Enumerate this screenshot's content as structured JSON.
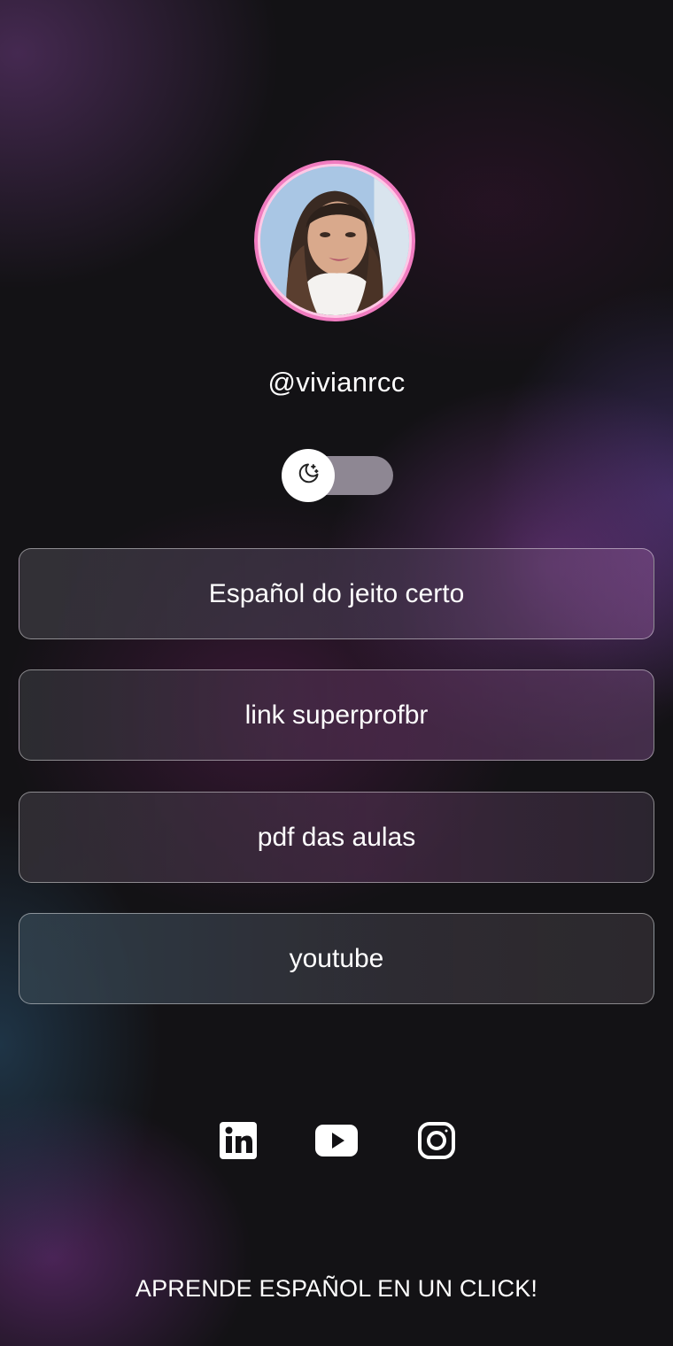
{
  "profile": {
    "username": "@vivianrcc"
  },
  "theme_toggle": {
    "icon": "moon-stars-icon",
    "state": "dark"
  },
  "links": [
    {
      "label": "Español do jeito certo"
    },
    {
      "label": "link superprofbr"
    },
    {
      "label": "pdf das aulas"
    },
    {
      "label": "youtube"
    }
  ],
  "socials": [
    {
      "icon": "linkedin-icon"
    },
    {
      "icon": "youtube-icon"
    },
    {
      "icon": "instagram-icon"
    }
  ],
  "footer": {
    "tagline": "APRENDE ESPAÑOL EN UN CLICK!"
  },
  "colors": {
    "avatar_ring": "#f07cc0",
    "text": "#ffffff",
    "toggle_track": "#8e8793"
  }
}
